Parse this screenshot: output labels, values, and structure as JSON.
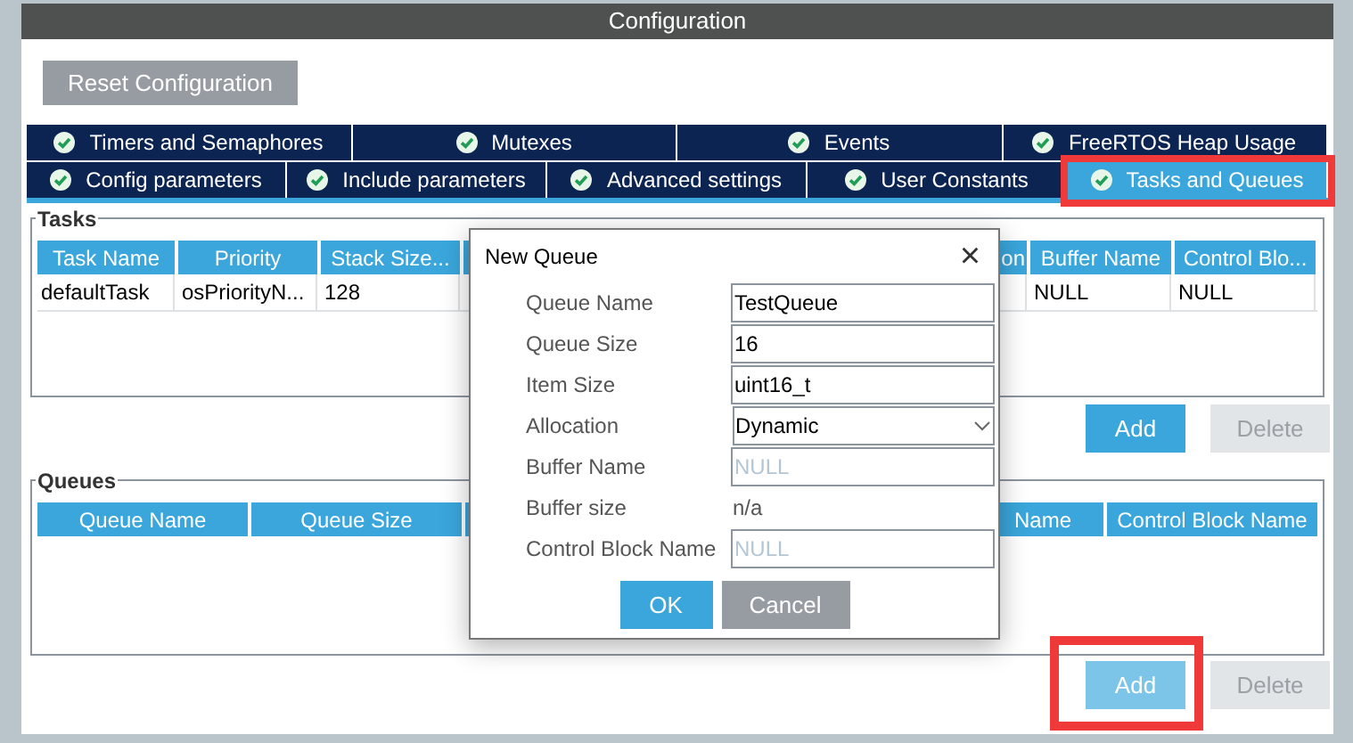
{
  "window": {
    "title": "Configuration"
  },
  "reset_button": "Reset Configuration",
  "tab_rows": [
    [
      {
        "label": "Timers and Semaphores",
        "selected": false,
        "highlighted": false
      },
      {
        "label": "Mutexes",
        "selected": false,
        "highlighted": false
      },
      {
        "label": "Events",
        "selected": false,
        "highlighted": false
      },
      {
        "label": "FreeRTOS Heap Usage",
        "selected": false,
        "highlighted": false
      }
    ],
    [
      {
        "label": "Config parameters",
        "selected": false,
        "highlighted": false
      },
      {
        "label": "Include parameters",
        "selected": false,
        "highlighted": false
      },
      {
        "label": "Advanced settings",
        "selected": false,
        "highlighted": false
      },
      {
        "label": "User Constants",
        "selected": false,
        "highlighted": false
      },
      {
        "label": "Tasks and Queues",
        "selected": true,
        "highlighted": true
      }
    ]
  ],
  "tasks": {
    "legend": "Tasks",
    "columns": [
      {
        "label": "Task Name"
      },
      {
        "label": "Priority"
      },
      {
        "label": "Stack Size..."
      },
      {},
      {},
      {},
      {
        "label": "on"
      },
      {
        "label": "Buffer Name"
      },
      {
        "label": "Control Blo..."
      }
    ],
    "rows": [
      [
        "defaultTask",
        "osPriorityN...",
        "128",
        null,
        null,
        null,
        null,
        "NULL",
        "NULL"
      ]
    ],
    "add_button": {
      "label": "Add",
      "hover": false
    },
    "delete_button": {
      "label": "Delete",
      "disabled": true
    }
  },
  "queues": {
    "legend": "Queues",
    "columns": [
      {
        "label": "Queue Name"
      },
      {
        "label": "Queue Size"
      },
      {},
      {},
      {
        "label": "Name"
      },
      {
        "label": "Control Block Name"
      }
    ],
    "add_button": {
      "label": "Add",
      "highlighted": true,
      "hover": true
    },
    "delete_button": {
      "label": "Delete",
      "disabled": true
    }
  },
  "dialog": {
    "title": "New Queue",
    "close": "×",
    "fields": [
      {
        "label": "Queue Name",
        "kind": "input",
        "value": "TestQueue"
      },
      {
        "label": "Queue Size",
        "kind": "input",
        "value": "16"
      },
      {
        "label": "Item Size",
        "kind": "input",
        "value": "uint16_t"
      },
      {
        "label": "Allocation",
        "kind": "select",
        "value": "Dynamic"
      },
      {
        "label": "Buffer Name",
        "kind": "input",
        "placeholder": "NULL"
      },
      {
        "label": "Buffer size",
        "kind": "text",
        "value": "n/a"
      },
      {
        "label": "Control Block Name",
        "kind": "input",
        "placeholder": "NULL"
      }
    ],
    "ok_button": "OK",
    "cancel_button": "Cancel"
  }
}
